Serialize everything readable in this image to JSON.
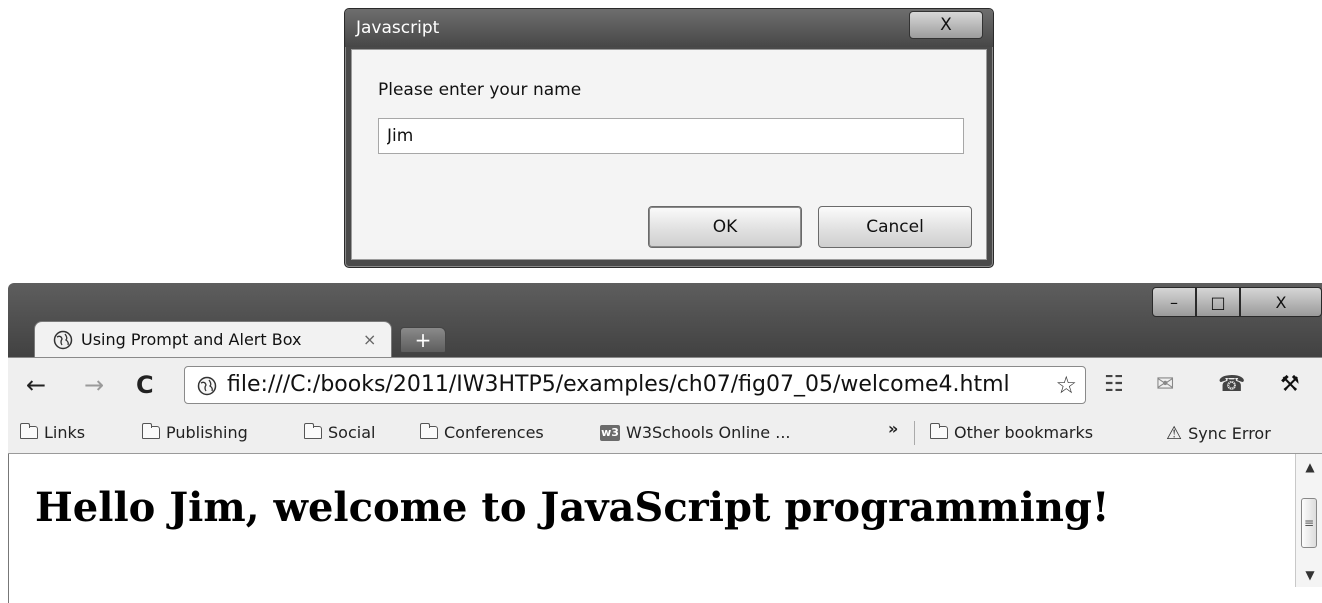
{
  "dialog": {
    "title": "Javascript",
    "close_glyph": "X",
    "message": "Please enter your name",
    "input_value": "Jim",
    "ok_label": "OK",
    "cancel_label": "Cancel"
  },
  "browser": {
    "window_controls": {
      "minimize": "–",
      "maximize": "□",
      "close": "X"
    },
    "tab": {
      "title": "Using Prompt and Alert Box",
      "close_glyph": "×",
      "icon": "globe-icon"
    },
    "new_tab_glyph": "+",
    "nav": {
      "back": "←",
      "forward": "→",
      "reload": "C"
    },
    "address": {
      "url": "file:///C:/books/2011/IW3HTP5/examples/ch07/fig07_05/welcome4.html",
      "star_icon": "☆"
    },
    "toolbar_icons": {
      "translate": "☷",
      "mail": "✉",
      "chat": "☎",
      "wrench": "⚒"
    },
    "bookmarks": [
      {
        "label": "Links",
        "icon": "folder-icon"
      },
      {
        "label": "Publishing",
        "icon": "folder-icon"
      },
      {
        "label": "Social",
        "icon": "folder-icon"
      },
      {
        "label": "Conferences",
        "icon": "folder-icon"
      },
      {
        "label": "W3Schools Online ...",
        "icon": "w3schools-icon"
      }
    ],
    "bookmarks_overflow": "»",
    "other_bookmarks": "Other bookmarks",
    "sync_error": "Sync Error",
    "sync_error_icon": "⚠",
    "content": {
      "heading": "Hello Jim, welcome to JavaScript programming!"
    },
    "scrollbar": {
      "up": "▲",
      "down": "▼",
      "grip": "≡"
    }
  }
}
